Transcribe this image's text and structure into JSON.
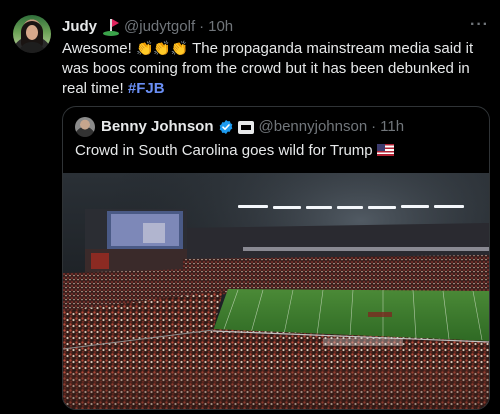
{
  "tweet": {
    "display_name": "Judy",
    "handle": "@judytgolf",
    "separator": "·",
    "time": "10h",
    "text_before": "Awesome! ",
    "claps": "👏👏👏",
    "text_after": " The propaganda mainstream media said it was boos coming from the crowd but it has been debunked in real time! ",
    "hashtag": "#FJB",
    "more": "···"
  },
  "quote": {
    "display_name": "Benny Johnson",
    "handle": "@bennyjohnson",
    "separator": "·",
    "time": "11h",
    "text": "Crowd in South Carolina goes wild for Trump"
  },
  "colors": {
    "background": "#000000",
    "text": "#e7e9ea",
    "secondary": "#71767b",
    "hashtag": "#6a8ff5",
    "verified": "#1d9bf0",
    "border": "#2f3336",
    "field": "#3d7a2e"
  },
  "icons": {
    "avatar": "profile-photo",
    "golf": "golf-flag-emoji",
    "verified": "verified-badge",
    "affiliate": "affiliate-badge",
    "flag": "us-flag-emoji",
    "more": "more-options"
  }
}
